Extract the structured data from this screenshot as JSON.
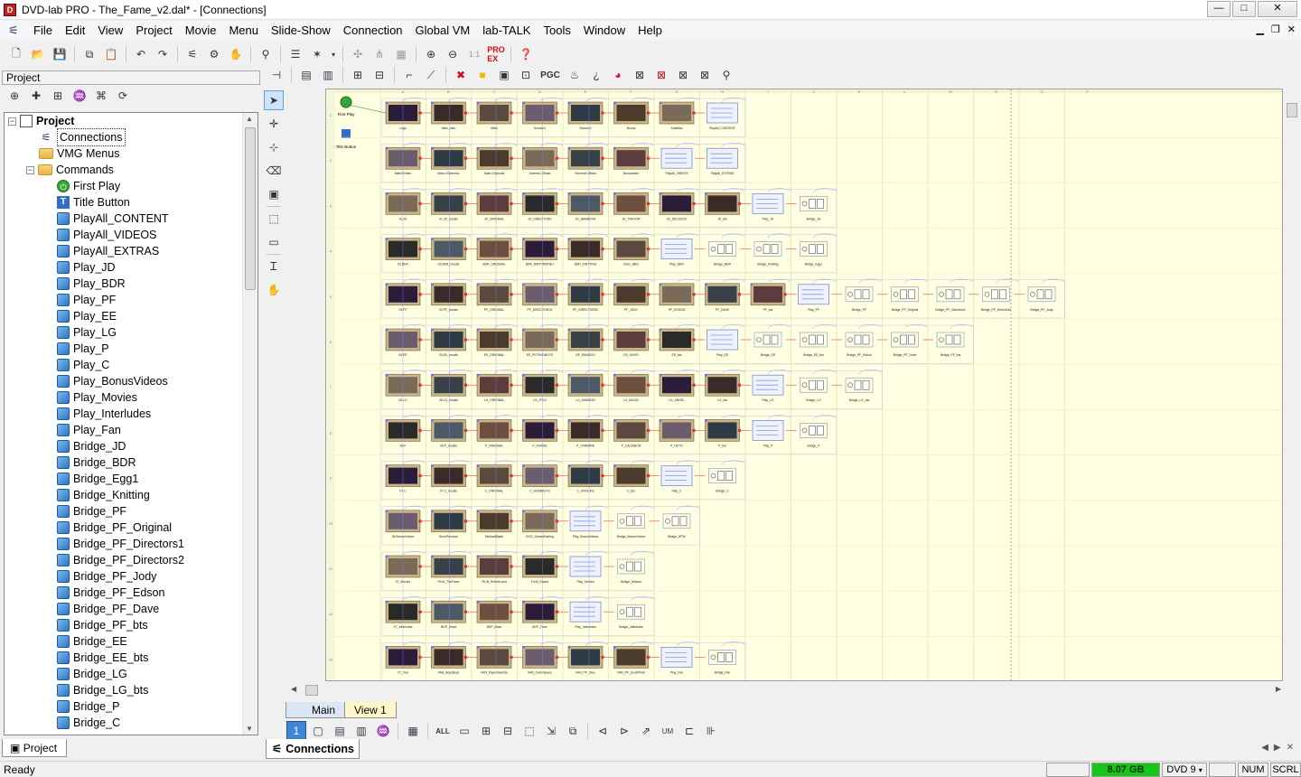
{
  "window": {
    "title": "DVD-lab PRO - The_Fame_v2.dal* - [Connections]",
    "app_icon": "dvdlab-icon",
    "controls": [
      "—",
      "□",
      "✕"
    ]
  },
  "menu": {
    "items": [
      "File",
      "Edit",
      "View",
      "Project",
      "Movie",
      "Menu",
      "Slide-Show",
      "Connection",
      "Global VM",
      "lab-TALK",
      "Tools",
      "Window",
      "Help"
    ]
  },
  "project_pane": {
    "header": "Project",
    "tab_label": "Project",
    "tree": {
      "root": "Project",
      "connections": "Connections",
      "vmg_menus": "VMG Menus",
      "commands": "Commands",
      "first_play": "First Play",
      "title_button": "Title Button",
      "commands_list": [
        "PlayAll_CONTENT",
        "PlayAll_VIDEOS",
        "PlayAll_EXTRAS",
        "Play_JD",
        "Play_BDR",
        "Play_PF",
        "Play_EE",
        "Play_LG",
        "Play_P",
        "Play_C",
        "Play_BonusVideos",
        "Play_Movies",
        "Play_Interludes",
        "Play_Fan",
        "Bridge_JD",
        "Bridge_BDR",
        "Bridge_Egg1",
        "Bridge_Knitting",
        "Bridge_PF",
        "Bridge_PF_Original",
        "Bridge_PF_Directors1",
        "Bridge_PF_Directors2",
        "Bridge_PF_Jody",
        "Bridge_PF_Edson",
        "Bridge_PF_Dave",
        "Bridge_PF_bts",
        "Bridge_EE",
        "Bridge_EE_bts",
        "Bridge_LG",
        "Bridge_LG_bts",
        "Bridge_P",
        "Bridge_C"
      ]
    }
  },
  "connections": {
    "first_play_label": "First Play",
    "title_button_label": "Title Button",
    "columns": [
      "A",
      "B",
      "C",
      "D",
      "E",
      "F",
      "G",
      "H",
      "I",
      "J",
      "K",
      "L",
      "M",
      "N",
      "O",
      "P"
    ],
    "rows": [
      [
        "Logo",
        "Main_intro",
        "Main",
        "Scenes1",
        "Scenes2",
        "Bonus",
        "Subtitles",
        "PlayAll_CONTENT"
      ],
      [
        "MainOVideo",
        "Main-OScenes1",
        "Main-OSpecial",
        "Scenes1-2Main",
        "Scenes2-2Main",
        "BonusMain",
        "PlayAll_VIDEOS",
        "PlayAll_EXTRAS"
      ],
      [
        "01.JD",
        "01.JD_results",
        "JD_ORIGINAL",
        "JD_DIRECTORS",
        "JD_BAMBOXA",
        "JD_TREVOR",
        "JD_DECUEZO",
        "JD_bts",
        "Play_JD",
        "Bridge_JD"
      ],
      [
        "02.BDR",
        "02.BDR_results",
        "BDR_ORIGINAL",
        "BDR_DIRTYMONEY",
        "BDR_KNITTING",
        "EGG_BBQ",
        "Play_BDR",
        "Bridge_BDR",
        "Bridge_Knitting",
        "Bridge_Egg1"
      ],
      [
        "03.PF",
        "03.PF_results",
        "PF_ORIGINAL",
        "PF_DIRECTORS1",
        "PF_DIRECTORS2",
        "PF_JODY",
        "PF_EDSON",
        "PF_DAVE",
        "PF_bts",
        "Play_PF",
        "Bridge_PF",
        "Bridge_PF_Original",
        "Bridge_PF_Directors1",
        "Bridge_PF_Directors2",
        "Bridge_PF_Jody"
      ],
      [
        "04.EE",
        "04.EE_results",
        "EE_ORIGINAL",
        "EE_PETEHDBOYS",
        "EE_RANGOU",
        "EE_SUHO",
        "EE_bts",
        "Play_EE",
        "Bridge_EE",
        "Bridge_EE_bts",
        "Bridge_PF_Edson",
        "Bridge_PF_Dave",
        "Bridge_PF_bts"
      ],
      [
        "05.LG",
        "05.LG_results",
        "LG_ORIGINAL",
        "LG_RT12",
        "LG_MANSON",
        "LG_MUSIC",
        "LG_ANGEL",
        "LG_bts",
        "Play_LG",
        "Bridge_LG",
        "Bridge_LG_bts"
      ],
      [
        "06.P",
        "06.P_results",
        "P_ORIGINAL",
        "P_HORSE",
        "P_CRIMORE",
        "P_CALANETA",
        "P_HOTO",
        "P_bts",
        "Play_P",
        "Bridge_P"
      ],
      [
        "07.C",
        "07.C_results",
        "C_ORIGINAL",
        "C_WOMBOYS",
        "C_KNOCKS",
        "C_bts",
        "Play_C",
        "Bridge_C"
      ],
      [
        "08.BonusVideos",
        "SemiPrecious",
        "MichaelBlade",
        "EGG_DesiesDarling",
        "Play_BonusVideos",
        "Bridge_BonusVideos",
        "Bridge_SPW"
      ],
      [
        "07_Movies",
        "FILM_TheFame",
        "FILM_RobertLand",
        "FILM_Dazed",
        "Play_Movies",
        "Bridge_Movies"
      ],
      [
        "X7_Interludes",
        "BDP_Head",
        "BDP_Brain",
        "BDP_Face",
        "Play_Interludes",
        "Bridge_Interludes"
      ],
      [
        "X7_Fan",
        "FAN_BoysBoys",
        "FAN_PaperGamsta",
        "FAN_OuterSpace",
        "FAN_PF_Oleo",
        "FAN_PF_SouthPark",
        "Play_Fan",
        "Bridge_Fan"
      ]
    ]
  },
  "view_tabs": [
    "Main",
    "View 1"
  ],
  "bottom_tool_labels": [
    "1",
    "ALL",
    "UM"
  ],
  "document_tab": "Connections",
  "status": {
    "ready": "Ready",
    "size": "8.07 GB",
    "disc": "DVD 9",
    "num": "NUM",
    "scrl": "SCRL"
  },
  "colors": {
    "canvas_bg": "#ffffe1",
    "link_blue": "#7b7bff",
    "link_red": "#d44",
    "status_green": "#17c41a"
  },
  "toolbar_labels": {
    "pgc": "PGC",
    "zoom_ratio": "1:1"
  }
}
